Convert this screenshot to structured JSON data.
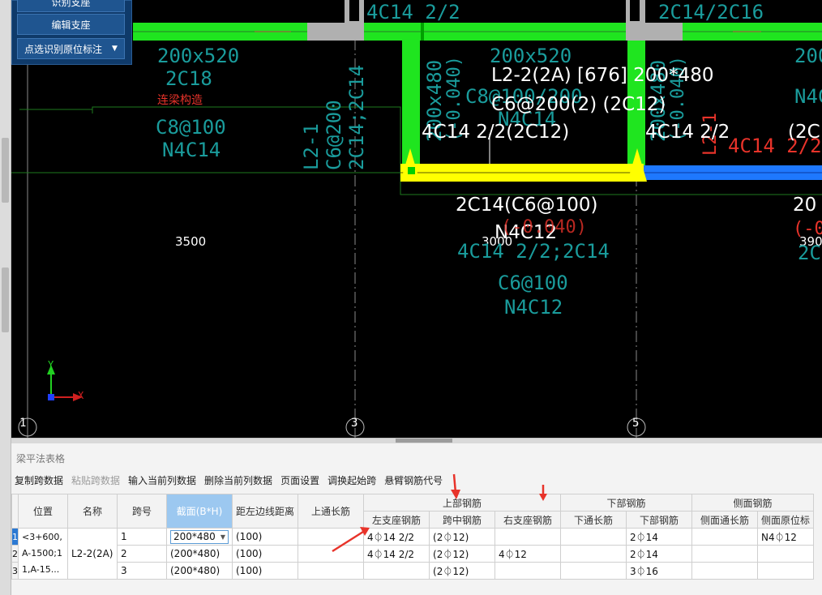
{
  "float_panel": {
    "buttons": [
      "识别支座",
      "编辑支座",
      "点选识别原位标注"
    ]
  },
  "cad": {
    "grid_numbers": [
      "1",
      "3",
      "5"
    ],
    "dims": [
      "3500",
      "3000",
      "390"
    ],
    "axis": {
      "x": "X",
      "y": "Y"
    },
    "labels": {
      "beam_a_size": "200x520",
      "beam_a_top": "2C18",
      "connect": "连梁构造",
      "beam_a_stirrup": "C8@100",
      "beam_a_side": "N4C14",
      "l21_name": "L2-1",
      "l21_stirrup": "C6@200",
      "l21_top": "2C14;2C14",
      "top_left": "4C14 2/2",
      "top_right": "2C14/2C16",
      "mid_size": "200x520",
      "mid_c8": "C8@100/200",
      "mid_n4": "N4C14",
      "vert_size": "200x480",
      "vert_elev": "(-0.040)",
      "beam_title": "L2-2(2A) [676] 200*480",
      "beam_stirrup": "C6@200(2) (2C12)",
      "support_left": "4C14 2/2(2C12)",
      "support_mid": "4C14 2/2",
      "support_right": "(2C",
      "red_support": "4C14 2/2",
      "red_l21": "L2-1",
      "below_main": "2C14(C6@100)",
      "below_n4": "N4C12",
      "below_elev": "(-0.040)",
      "below_size": "200x480",
      "below_4c14": "4C14 2/2;2C14",
      "below_c6": "C6@100",
      "below_n4c12": "N4C12",
      "right_top": "200",
      "right_n4": "N4C",
      "right_20": "20",
      "right_neg": "(-0",
      "right_2c": "2C"
    }
  },
  "panel": {
    "title": "梁平法表格",
    "toolbar": [
      "复制跨数据",
      "粘贴跨数据",
      "输入当前列数据",
      "删除当前列数据",
      "页面设置",
      "调换起始跨",
      "悬臂钢筋代号"
    ],
    "headers": {
      "position": "位置",
      "name": "名称",
      "span": "跨号",
      "section": "截面(B*H)",
      "edge_dist": "距左边线距离",
      "top_through": "上通长筋",
      "top_rebar": "上部钢筋",
      "left_support": "左支座钢筋",
      "mid_span": "跨中钢筋",
      "right_support": "右支座钢筋",
      "bottom_rebar": "下部钢筋",
      "bottom_through": "下通长筋",
      "bottom": "下部钢筋",
      "side_rebar": "侧面钢筋",
      "side_through": "侧面通长筋",
      "side_original": "侧面原位标"
    },
    "position_text": [
      "<3+600,",
      "A-1500;1",
      "1,A-15..."
    ],
    "name_text": "L2-2(2A)",
    "rows": [
      {
        "num": "1",
        "span": "1",
        "section": "200*480",
        "edge": "(100)",
        "top_through": "",
        "left": "4⏀14 2/2",
        "mid": "(2⏀12)",
        "right": "",
        "bottom_through": "",
        "bottom": "2⏀14",
        "side_through": "",
        "side_orig": "N4⏀12"
      },
      {
        "num": "2",
        "span": "2",
        "section": "(200*480)",
        "edge": "(100)",
        "top_through": "",
        "left": "4⏀14 2/2",
        "mid": "(2⏀12)",
        "right": "4⏀12",
        "bottom_through": "",
        "bottom": "2⏀14",
        "side_through": "",
        "side_orig": ""
      },
      {
        "num": "3",
        "span": "3",
        "section": "(200*480)",
        "edge": "(100)",
        "top_through": "",
        "left": "",
        "mid": "(2⏀12)",
        "right": "",
        "bottom_through": "",
        "bottom": "3⏀16",
        "side_through": "",
        "side_orig": ""
      }
    ]
  },
  "colors": {
    "beam_green": "#1fe51f",
    "selected_yellow": "#ffff00",
    "cad_cyan": "#1a9c9c",
    "annot_red": "#e8332a",
    "header_blue": "#9cc8f0"
  }
}
